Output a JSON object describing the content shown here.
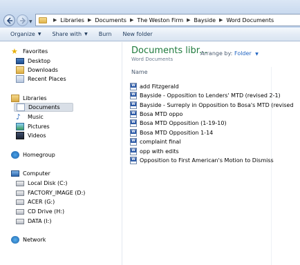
{
  "breadcrumb": [
    "Libraries",
    "Documents",
    "The Weston Firm",
    "Bayside",
    "Word Documents"
  ],
  "toolbar": {
    "organize": "Organize",
    "share_with": "Share with",
    "burn": "Burn",
    "new_folder": "New folder"
  },
  "nav": {
    "favorites": {
      "label": "Favorites",
      "icon": "star-icon"
    },
    "desktop": "Desktop",
    "downloads": "Downloads",
    "recent_places": "Recent Places",
    "libraries": "Libraries",
    "documents": "Documents",
    "music": "Music",
    "pictures": "Pictures",
    "videos": "Videos",
    "homegroup": "Homegroup",
    "computer": "Computer",
    "drives": [
      "Local Disk (C:)",
      "FACTORY_IMAGE (D:)",
      "ACER (G:)",
      "CD Drive (H:)",
      "DATA (I:)"
    ],
    "network": "Network"
  },
  "content": {
    "title": "Documents libr...",
    "subtitle": "Word Documents",
    "arrange_label": "Arrange by:",
    "arrange_value": "Folder",
    "column_name": "Name",
    "files": [
      "add Fitzgerald",
      "Bayside - Opposition to Lenders' MTD (revised 2-1)",
      "Bayside - Surreply in Opposition to Bosa's MTD (revised",
      "Bosa MTD oppo",
      "Bosa MTD Opposition (1-19-10)",
      "Bosa MTD Opposition 1-14",
      "complaint final",
      "opp with edits",
      "Opposition to First American's Motion to Dismiss"
    ]
  },
  "colors": {
    "library_title": "#1e7a3c",
    "toolbar_text": "#1e395b",
    "link_blue": "#1f63c2",
    "selected_bg": "#d9dfe7"
  }
}
